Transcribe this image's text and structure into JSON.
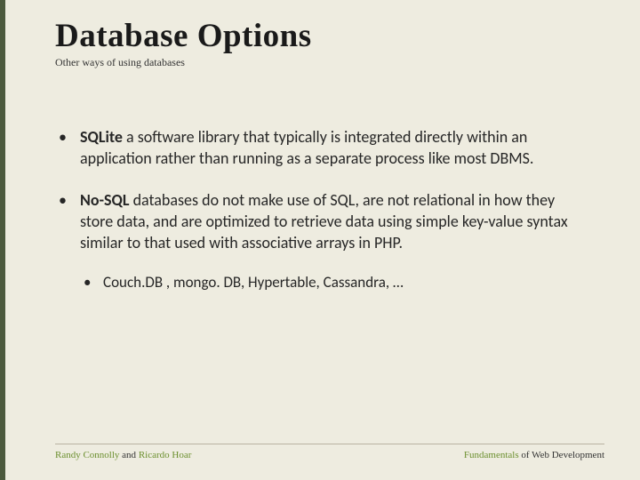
{
  "title": "Database Options",
  "subtitle": "Other ways of using databases",
  "bullets": {
    "b1": {
      "strong": "SQLite",
      "rest": " a software library that typically is integrated directly within an application rather than running as a separate process like most DBMS."
    },
    "b2": {
      "strong": "No-SQL",
      "rest": " databases do not make use of SQL, are not relational in how they store data, and are optimized to retrieve data using simple key-value syntax similar to that used with associative arrays in PHP.",
      "sub": "Couch.DB , mongo. DB, Hypertable, Cassandra, …"
    }
  },
  "footer": {
    "left_a": "Randy Connolly ",
    "left_mid": "and ",
    "left_b": "Ricardo Hoar",
    "right_a": "Fundamentals ",
    "right_b": "of Web Development"
  }
}
